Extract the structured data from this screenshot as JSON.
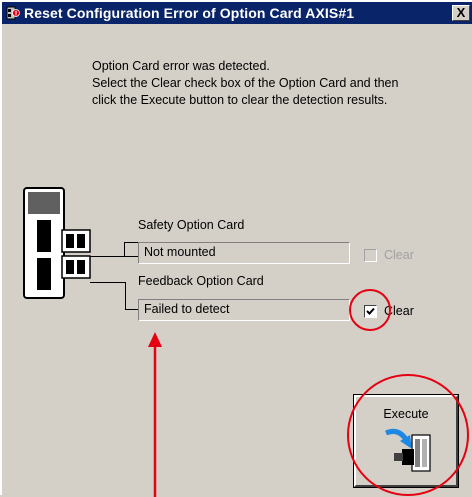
{
  "window": {
    "title": "Reset Configuration Error of Option Card AXIS#1",
    "close_glyph": "X"
  },
  "message": {
    "line1": "Option Card error was detected.",
    "line2": "Select the Clear check box of the Option Card and then",
    "line3": "click the Execute button to clear the detection results."
  },
  "safety": {
    "label": "Safety Option Card",
    "value": "Not mounted",
    "clear_label": "Clear",
    "clear_checked": false,
    "clear_enabled": false
  },
  "feedback": {
    "label": "Feedback Option Card",
    "value": "Failed to detect",
    "clear_label": "Clear",
    "clear_checked": true,
    "clear_enabled": true
  },
  "execute": {
    "label": "Execute"
  },
  "colors": {
    "titlebar": "#0a246a",
    "dialog_bg": "#d4d0c8",
    "annotation_red": "#e60012"
  },
  "icons": {
    "title": "device-error-icon",
    "device": "servo-drive-device-icon",
    "execute": "reset-arrow-device-icon"
  }
}
